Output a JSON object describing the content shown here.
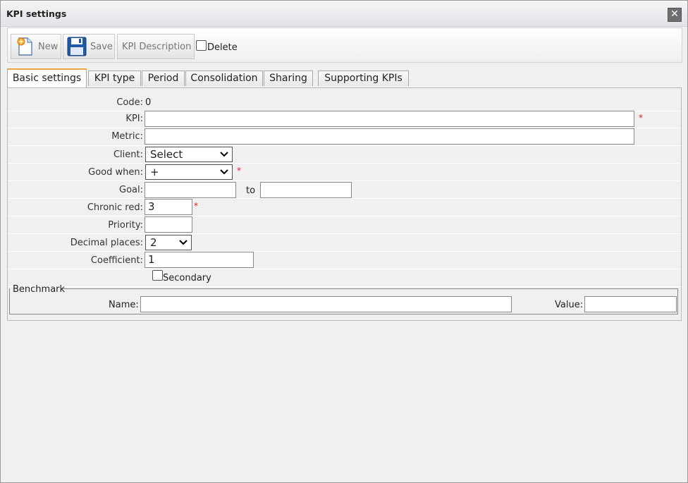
{
  "window": {
    "title": "KPI settings"
  },
  "toolbar": {
    "new_label": "New",
    "save_label": "Save",
    "kpi_description_label": "KPI Description",
    "delete_label": "Delete"
  },
  "tabs": [
    {
      "label": "Basic settings"
    },
    {
      "label": "KPI type"
    },
    {
      "label": "Period"
    },
    {
      "label": "Consolidation"
    },
    {
      "label": "Sharing"
    },
    {
      "label": "Supporting KPIs"
    }
  ],
  "form": {
    "code_label": "Code:",
    "code_value": "0",
    "kpi_label": "KPI:",
    "kpi_value": "",
    "metric_label": "Metric:",
    "metric_value": "",
    "client_label": "Client:",
    "client_value": "Select",
    "good_when_label": "Good when:",
    "good_when_value": "+",
    "goal_label": "Goal:",
    "goal_from": "",
    "goal_to_label": "to",
    "goal_to": "",
    "chronic_red_label": "Chronic red:",
    "chronic_red_value": "3",
    "priority_label": "Priority:",
    "priority_value": "",
    "decimal_places_label": "Decimal places:",
    "decimal_places_value": "2",
    "coefficient_label": "Coefficient:",
    "coefficient_value": "1",
    "secondary_label": "Secondary",
    "required_mark": "*"
  },
  "benchmark": {
    "legend": "Benchmark",
    "name_label": "Name:",
    "name_value": "",
    "value_label": "Value:",
    "value_value": ""
  },
  "colors": {
    "active_tab_accent": "#f0a63a",
    "required": "#dd2222"
  }
}
